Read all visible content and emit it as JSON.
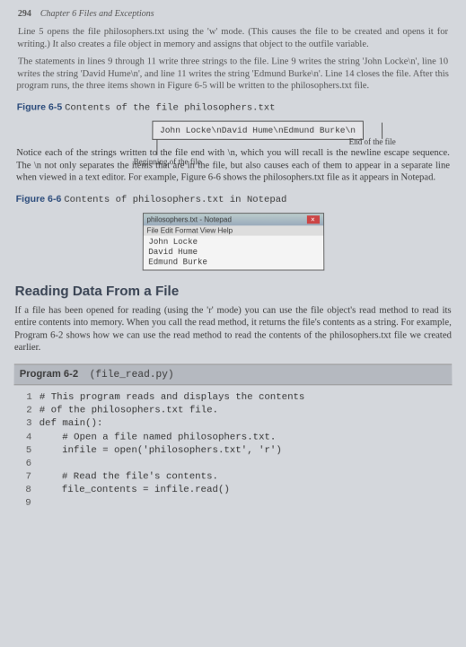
{
  "header": {
    "page_number": "294",
    "chapter": "Chapter 6  Files and Exceptions"
  },
  "intro_para1": "Line 5 opens the file philosophers.txt using the 'w' mode. (This causes the file to be created and opens it for writing.) It also creates a file object in memory and assigns that object to the outfile variable.",
  "intro_para2": "The statements in lines 9 through 11 write three strings to the file. Line 9 writes the string 'John Locke\\n', line 10 writes the string 'David Hume\\n', and line 11 writes the string 'Edmund Burke\\n'. Line 14 closes the file. After this program runs, the three items shown in Figure 6-5 will be written to the philosophers.txt file.",
  "figure65": {
    "label": "Figure 6-5",
    "title": "Contents of the file philosophers.txt",
    "filebox": "John Locke\\nDavid Hume\\nEdmund Burke\\n",
    "beginning": "Beginning of the file",
    "end": "End of the file"
  },
  "para_notice": "Notice each of the strings written to the file end with \\n, which you will recall is the newline escape sequence. The \\n not only separates the items that are in the file, but also causes each of them to appear in a separate line when viewed in a text editor. For example, Figure 6-6 shows the philosophers.txt file as it appears in Notepad.",
  "figure66": {
    "label": "Figure 6-6",
    "title": "Contents of philosophers.txt in Notepad",
    "window_title": "philosophers.txt - Notepad",
    "menu": "File  Edit  Format  View  Help",
    "line1": "John Locke",
    "line2": "David Hume",
    "line3": "Edmund Burke"
  },
  "reading": {
    "heading": "Reading Data From a File",
    "para": "If a file has been opened for reading (using the 'r' mode) you can use the file object's read method to read its entire contents into memory. When you call the read method, it returns the file's contents as a string. For example, Program 6-2 shows how we can use the read method to read the contents of the philosophers.txt file we created earlier."
  },
  "program": {
    "label": "Program 6-2",
    "filename": "(file_read.py)"
  },
  "code": {
    "l1": "# This program reads and displays the contents",
    "l2": "# of the philosophers.txt file.",
    "l3": "def main():",
    "l4": "    # Open a file named philosophers.txt.",
    "l5": "    infile = open('philosophers.txt', 'r')",
    "l6": "",
    "l7": "    # Read the file's contents.",
    "l8": "    file_contents = infile.read()",
    "l9": ""
  }
}
